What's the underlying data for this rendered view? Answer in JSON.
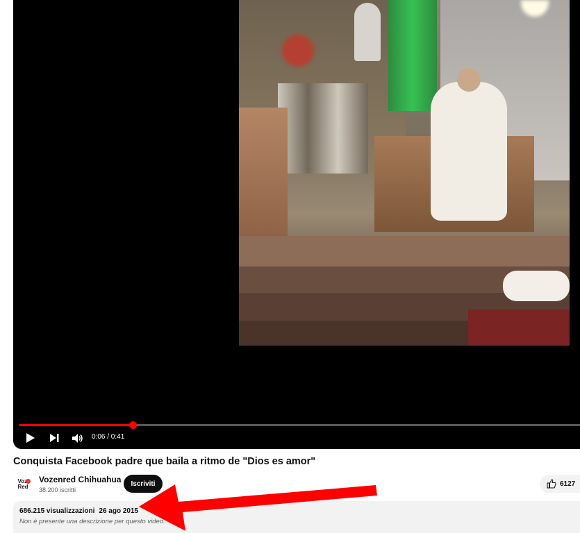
{
  "player": {
    "time_display": "0:06 / 0:41",
    "progress_fraction": 0.2,
    "accent_color": "#ff0000",
    "icons": {
      "play": "play-icon",
      "next": "next-icon",
      "volume": "volume-icon"
    }
  },
  "video": {
    "title": "Conquista Facebook padre que baila a ritmo de \"Dios es amor\""
  },
  "channel": {
    "avatar_text_line1": "Voz",
    "avatar_text_line2": "en",
    "avatar_text_line3": "Red",
    "name": "Vozenred Chihuahua",
    "subscribers": "38.200 iscritti",
    "subscribe_label": "Iscriviti"
  },
  "actions": {
    "like_count": "6127",
    "like_icon": "thumbs-up-icon"
  },
  "description": {
    "views": "686.215 visualizzazioni",
    "date": "26 ago 2015",
    "empty_text": "Non è presente una descrizione per questo video."
  },
  "annotation": {
    "color": "#ff0000"
  }
}
